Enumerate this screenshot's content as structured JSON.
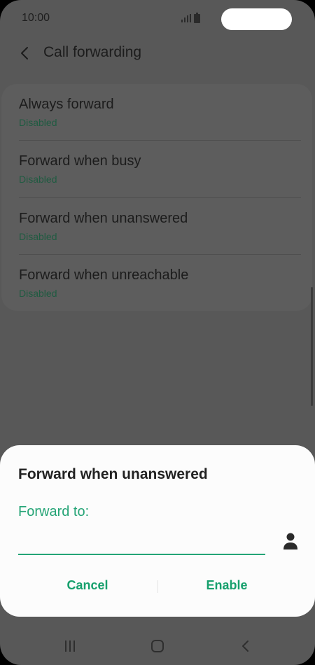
{
  "status_bar": {
    "time": "10:00"
  },
  "header": {
    "title": "Call forwarding"
  },
  "items": [
    {
      "title": "Always forward",
      "status": "Disabled"
    },
    {
      "title": "Forward when busy",
      "status": "Disabled"
    },
    {
      "title": "Forward when unanswered",
      "status": "Disabled"
    },
    {
      "title": "Forward when unreachable",
      "status": "Disabled"
    }
  ],
  "dialog": {
    "title": "Forward when unanswered",
    "label": "Forward to:",
    "input_value": "",
    "cancel_label": "Cancel",
    "enable_label": "Enable"
  },
  "colors": {
    "accent": "#25a476",
    "status_text": "#1f5b41",
    "scrim_bg": "#585858"
  },
  "icons": {
    "back": "chevron-left-icon",
    "contact": "person-icon",
    "signal": "signal-icon",
    "battery": "battery-icon",
    "nav_recents": "recents-icon",
    "nav_home": "home-icon",
    "nav_back": "back-icon"
  }
}
